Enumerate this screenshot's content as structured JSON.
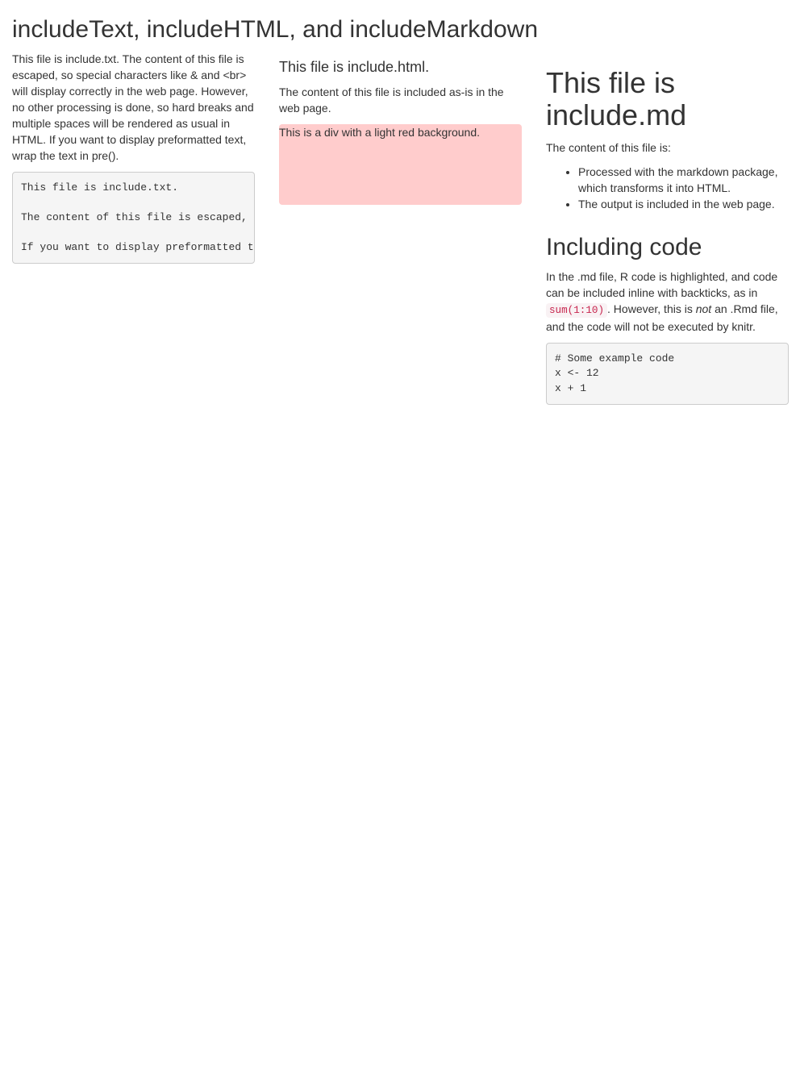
{
  "page": {
    "title": "includeText, includeHTML, and includeMarkdown"
  },
  "col_text": {
    "paragraph": "This file is include.txt. The content of this file is escaped, so special characters like & and <br> will display correctly in the web page. However, no other processing is done, so hard breaks and multiple spaces will be rendered as usual in HTML. If you want to display preformatted text, wrap the text in pre().",
    "pre": "This file is include.txt.\n\nThe content of this file is escaped, so special characters like & and <br> will display correctly in the web page. However, no other processing is done, so hard breaks and multiple spaces will be rendered as usual in HTML.\n\nIf you want to display preformatted text, wrap the text in pre()."
  },
  "col_html": {
    "heading": "This file is include.html.",
    "paragraph": "The content of this file is included as-is in the web page.",
    "div_text": "This is a div with a light red background.",
    "div_color": "#ffcccc"
  },
  "col_md": {
    "heading": "This file is include.md",
    "intro": "The content of this file is:",
    "bullets": [
      "Processed with the markdown package, which transforms it into HTML.",
      "The output is included in the web page."
    ],
    "subheading": "Including code",
    "para_part1": "In the .md file, R code is highlighted, and code can be included inline with backticks, as in ",
    "inline_code": "sum(1:10)",
    "para_part2": ". However, this is ",
    "para_em": "not",
    "para_part3": " an .Rmd file, and the code will not be executed by knitr.",
    "code_block": "# Some example code\nx <- 12\nx + 1"
  }
}
